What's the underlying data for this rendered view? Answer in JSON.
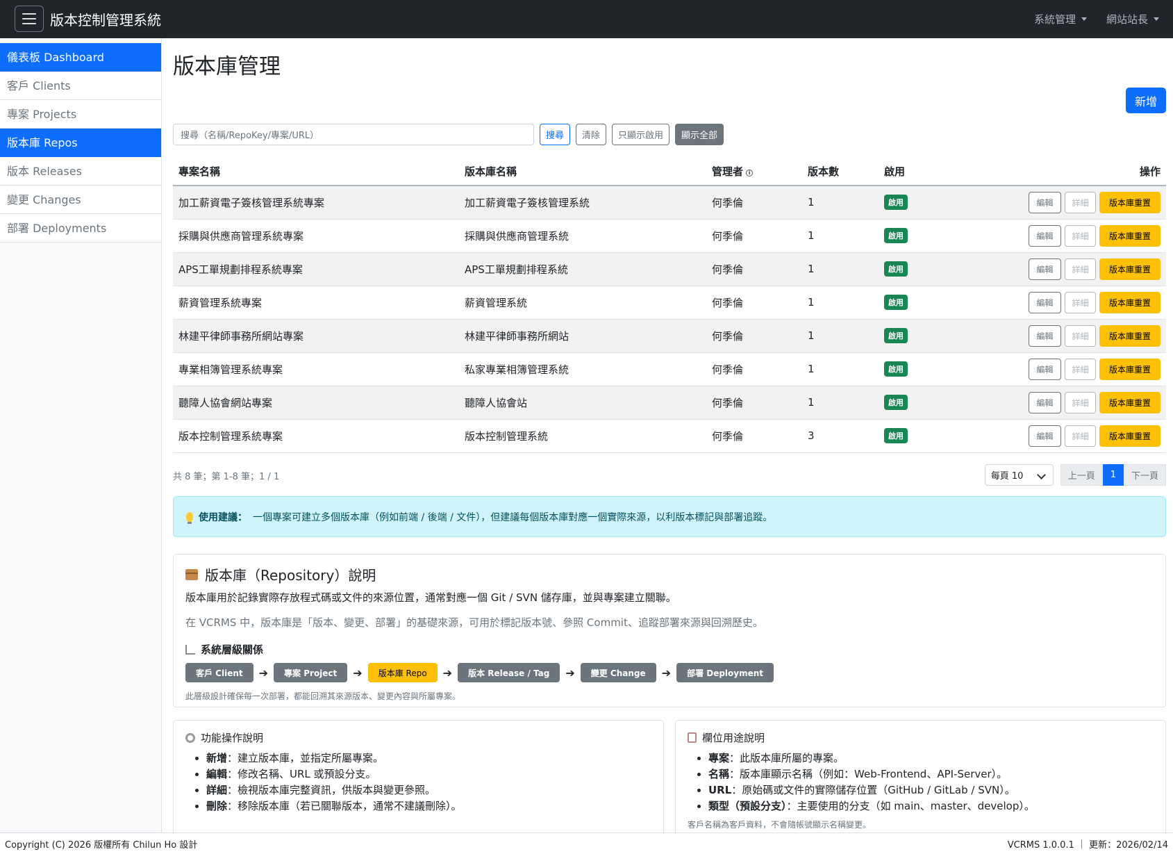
{
  "navbar": {
    "brand": "版本控制管理系統",
    "menu_system": "系統管理",
    "menu_user": "網站站長"
  },
  "sidebar": {
    "items": [
      {
        "label": "儀表板 Dashboard",
        "active": true
      },
      {
        "label": "客戶 Clients",
        "active": false
      },
      {
        "label": "專案 Projects",
        "active": false
      },
      {
        "label": "版本庫 Repos",
        "active": true
      },
      {
        "label": "版本 Releases",
        "active": false
      },
      {
        "label": "變更 Changes",
        "active": false
      },
      {
        "label": "部署 Deployments",
        "active": false
      }
    ]
  },
  "page": {
    "title": "版本庫管理",
    "add_button": "新增"
  },
  "search": {
    "placeholder": "搜尋（名稱/RepoKey/專案/URL）",
    "search_button": "搜尋",
    "clear_button": "清除",
    "only_enabled_button": "只顯示啟用",
    "show_all_button": "顯示全部"
  },
  "table": {
    "headers": {
      "project": "專案名稱",
      "repo": "版本庫名稱",
      "manager": "管理者",
      "versions": "版本數",
      "enabled": "啟用",
      "actions": "操作"
    },
    "rows": [
      {
        "project": "加工薪資電子簽核管理系統專案",
        "repo": "加工薪資電子簽核管理系統",
        "manager": "何季倫",
        "versions": "1",
        "enabled": "啟用"
      },
      {
        "project": "採購與供應商管理系統專案",
        "repo": "採購與供應商管理系統",
        "manager": "何季倫",
        "versions": "1",
        "enabled": "啟用"
      },
      {
        "project": "APS工單規劃排程系統專案",
        "repo": "APS工單規劃排程系統",
        "manager": "何季倫",
        "versions": "1",
        "enabled": "啟用"
      },
      {
        "project": "薪資管理系統專案",
        "repo": "薪資管理系統",
        "manager": "何季倫",
        "versions": "1",
        "enabled": "啟用"
      },
      {
        "project": "林建平律師事務所網站專案",
        "repo": "林建平律師事務所網站",
        "manager": "何季倫",
        "versions": "1",
        "enabled": "啟用"
      },
      {
        "project": "專業相簿管理系統專案",
        "repo": "私家專業相簿管理系統",
        "manager": "何季倫",
        "versions": "1",
        "enabled": "啟用"
      },
      {
        "project": "聽障人協會網站專案",
        "repo": "聽障人協會站",
        "manager": "何季倫",
        "versions": "1",
        "enabled": "啟用"
      },
      {
        "project": "版本控制管理系統專案",
        "repo": "版本控制管理系統",
        "manager": "何季倫",
        "versions": "3",
        "enabled": "啟用"
      }
    ],
    "action_labels": {
      "edit": "編輯",
      "detail": "詳細",
      "reset": "版本庫重置"
    }
  },
  "pagination": {
    "summary": "共 8 筆；第 1-8 筆；1 / 1",
    "page_size": "每頁 10",
    "prev": "上一頁",
    "current": "1",
    "next": "下一頁"
  },
  "tip": {
    "label": "使用建議：",
    "text": "一個專案可建立多個版本庫（例如前端 / 後端 / 文件），但建議每個版本庫對應一個實際來源，以利版本標記與部署追蹤。"
  },
  "repo_info": {
    "title": "版本庫（Repository）說明",
    "p1": "版本庫用於記錄實際存放程式碼或文件的來源位置，通常對應一個 Git / SVN 儲存庫，並與專案建立關聯。",
    "p2": "在 VCRMS 中，版本庫是「版本、變更、部署」的基礎來源，可用於標記版本號、參照 Commit、追蹤部署來源與回溯歷史。",
    "hierarchy_title": "系統層級關係",
    "flow": [
      "客戶 Client",
      "專案 Project",
      "版本庫 Repo",
      "版本 Release / Tag",
      "變更 Change",
      "部署 Deployment"
    ],
    "foot": "此層級設計確保每一次部署，都能回溯其來源版本、變更內容與所屬專案。"
  },
  "ops": {
    "title": "功能操作說明",
    "items": [
      {
        "term": "新增",
        "desc": "：建立版本庫，並指定所屬專案。"
      },
      {
        "term": "編輯",
        "desc": "：修改名稱、URL 或預設分支。"
      },
      {
        "term": "詳細",
        "desc": "：檢視版本庫完整資訊，供版本與變更參照。"
      },
      {
        "term": "刪除",
        "desc": "：移除版本庫（若已關聯版本，通常不建議刪除）。"
      }
    ]
  },
  "fields": {
    "title": "欄位用途說明",
    "items": [
      {
        "term": "專案",
        "desc": "：此版本庫所屬的專案。"
      },
      {
        "term": "名稱",
        "desc": "：版本庫顯示名稱（例如：Web-Frontend、API-Server）。"
      },
      {
        "term": "URL",
        "desc": "：原始碼或文件的實際儲存位置（GitHub / GitLab / SVN）。"
      },
      {
        "term": "類型（預設分支）",
        "desc": "：主要使用的分支（如 main、master、develop）。"
      }
    ],
    "note": "客戶名稱為客戶資料，不會隨帳號顯示名稱變更。"
  },
  "footer": {
    "copyright": "Copyright (C) 2026 版權所有 Chilun Ho 設計",
    "version": "VCRMS 1.0.0.1 ｜ 更新：2026/02/14"
  },
  "colors": {
    "primary": "#0d6efd",
    "success": "#198754",
    "warning": "#ffc107",
    "secondary": "#6c757d",
    "navbar": "#212529",
    "info_bg": "#cff4fc"
  }
}
